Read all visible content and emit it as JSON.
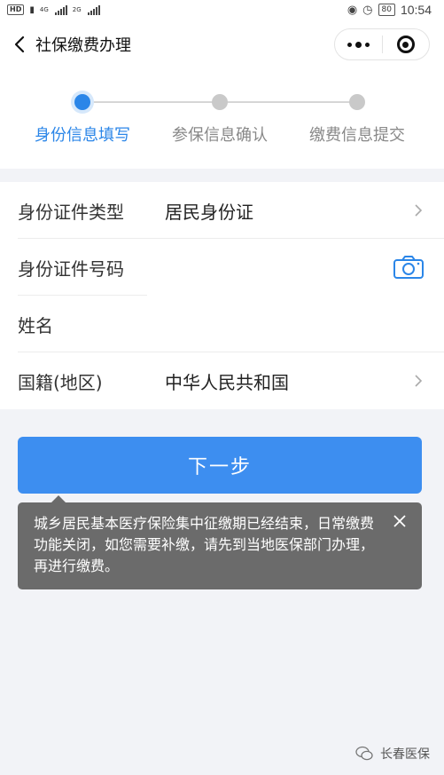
{
  "status_bar": {
    "hd": "HD",
    "net1": "4G",
    "net2": "2G",
    "battery": "80",
    "time": "10:54"
  },
  "nav": {
    "title": "社保缴费办理"
  },
  "steps": [
    {
      "label": "身份信息填写",
      "active": true
    },
    {
      "label": "参保信息确认",
      "active": false
    },
    {
      "label": "缴费信息提交",
      "active": false
    }
  ],
  "form": {
    "rows": [
      {
        "label": "身份证件类型",
        "value": "居民身份证"
      },
      {
        "label": "身份证件号码",
        "value": ""
      },
      {
        "label": "姓名",
        "value": ""
      },
      {
        "label": "国籍(地区)",
        "value": "中华人民共和国"
      }
    ]
  },
  "next_button": "下一步",
  "tooltip": {
    "message": "城乡居民基本医疗保险集中征缴期已经结束，日常缴费功能关闭，如您需要补缴，请先到当地医保部门办理，再进行缴费。"
  },
  "watermark": "长春医保",
  "colors": {
    "accent": "#2b86e8",
    "button": "#3d8ef0",
    "tooltip_bg": "#6b6b6b",
    "page_bg": "#f2f3f7"
  }
}
